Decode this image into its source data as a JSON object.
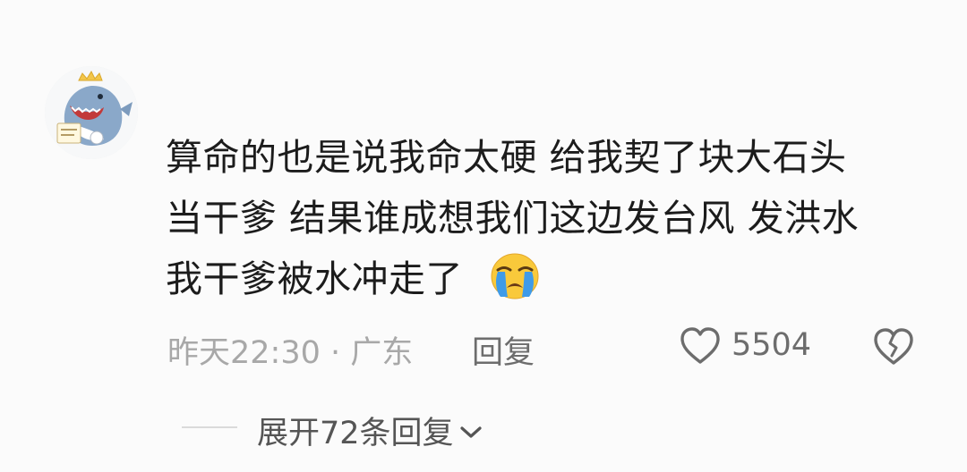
{
  "comment": {
    "lines": [
      "算命的也是说我命太硬 给我契了块大石头",
      "当干爹 结果谁成想我们这边发台风 发洪水",
      "我干爹被水冲走了"
    ],
    "emoji": "loudly-crying-face"
  },
  "meta": {
    "time_location": "昨天22:30 · 广东",
    "reply_label": "回复",
    "like_count": "5504"
  },
  "replies": {
    "expand_label": "展开72条回复"
  },
  "icons": {
    "like": "heart-icon",
    "dislike": "broken-heart-icon",
    "expand": "chevron-down-icon"
  },
  "colors": {
    "text": "#1c1c1c",
    "muted": "#a8a8a8",
    "action": "#6d6d6d"
  }
}
